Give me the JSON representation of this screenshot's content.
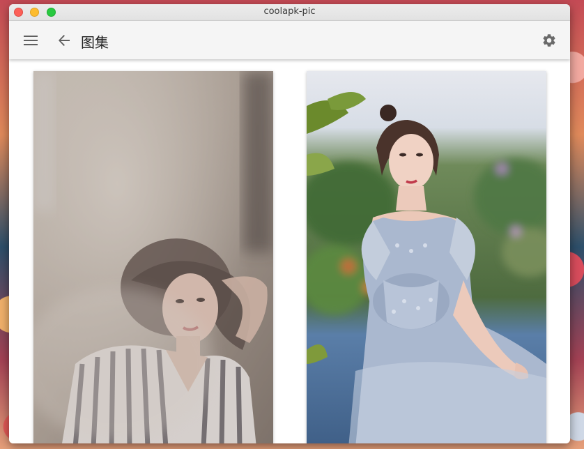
{
  "window": {
    "title": "coolapk-pic"
  },
  "appbar": {
    "title": "图集",
    "menu_icon": "menu-icon",
    "back_icon": "arrow-left-icon",
    "settings_icon": "gear-icon",
    "background": "#f5f5f5"
  },
  "gallery": {
    "images": [
      {
        "description_icon": "photo-portrait-striped-shirt"
      },
      {
        "description_icon": "photo-portrait-blue-gown"
      }
    ]
  }
}
